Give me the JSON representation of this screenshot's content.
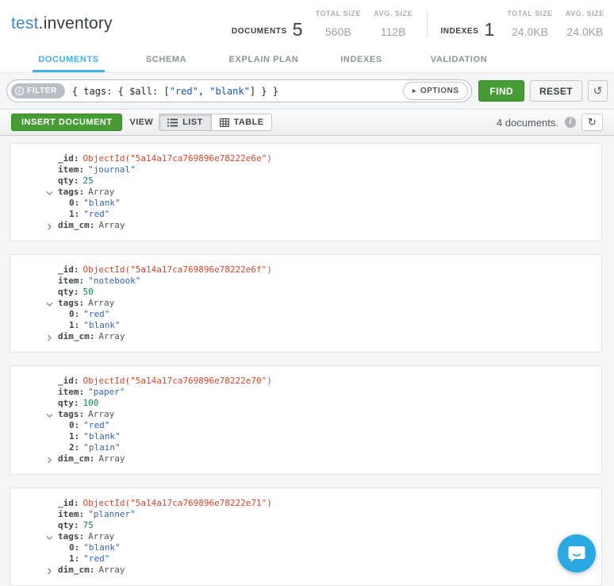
{
  "colors": {
    "accent_blue": "#43b1e4",
    "namespace_db_blue": "#4386c9",
    "button_green": "#469b35",
    "chat_blue": "#29a9e1",
    "objectid_red": "#d4472b",
    "string_blue": "#3265b4",
    "number_green": "#11824b"
  },
  "header": {
    "namespace": {
      "database": "test",
      "separator": ".",
      "collection": "inventory"
    },
    "stats": {
      "documents_label": "DOCUMENTS",
      "documents_count": "5",
      "documents_total_size_label": "TOTAL SIZE",
      "documents_total_size": "560B",
      "documents_avg_size_label": "AVG. SIZE",
      "documents_avg_size": "112B",
      "indexes_label": "INDEXES",
      "indexes_count": "1",
      "indexes_total_size_label": "TOTAL SIZE",
      "indexes_total_size": "24.0KB",
      "indexes_avg_size_label": "AVG. SIZE",
      "indexes_avg_size": "24.0KB"
    }
  },
  "tabs": [
    {
      "label": "DOCUMENTS",
      "active": true
    },
    {
      "label": "SCHEMA",
      "active": false
    },
    {
      "label": "EXPLAIN PLAN",
      "active": false
    },
    {
      "label": "INDEXES",
      "active": false
    },
    {
      "label": "VALIDATION",
      "active": false
    }
  ],
  "filter": {
    "badge_label": "FILTER",
    "badge_info_glyph": "i",
    "query_prefix": "{ tags: { $all: [",
    "query_string_1": "\"red\"",
    "query_separator": ", ",
    "query_string_2": "\"blank\"",
    "query_suffix": "] } }",
    "options_caret_glyph": "▸",
    "options_label": "OPTIONS",
    "find_label": "FIND",
    "reset_label": "RESET",
    "history_icon_glyph": "↺"
  },
  "toolbar": {
    "insert_label": "INSERT DOCUMENT",
    "view_label": "VIEW",
    "list_label": "LIST",
    "table_label": "TABLE",
    "count_text": "4 documents.",
    "info_icon_glyph": "i",
    "refresh_icon_glyph": "↻"
  },
  "documents": [
    {
      "fields": [
        {
          "key": "_id",
          "type": "objectid",
          "value": "ObjectId(\"5a14a17ca769896e78222e6e\")"
        },
        {
          "key": "item",
          "type": "string",
          "value": "\"journal\""
        },
        {
          "key": "qty",
          "type": "number",
          "value": "25"
        },
        {
          "key": "tags",
          "type": "array",
          "value": "Array",
          "expanded": true,
          "children": [
            {
              "key": "0",
              "type": "string",
              "value": "\"blank\""
            },
            {
              "key": "1",
              "type": "string",
              "value": "\"red\""
            }
          ]
        },
        {
          "key": "dim_cm",
          "type": "array",
          "value": "Array",
          "expanded": false
        }
      ]
    },
    {
      "fields": [
        {
          "key": "_id",
          "type": "objectid",
          "value": "ObjectId(\"5a14a17ca769896e78222e6f\")"
        },
        {
          "key": "item",
          "type": "string",
          "value": "\"notebook\""
        },
        {
          "key": "qty",
          "type": "number",
          "value": "50"
        },
        {
          "key": "tags",
          "type": "array",
          "value": "Array",
          "expanded": true,
          "children": [
            {
              "key": "0",
              "type": "string",
              "value": "\"red\""
            },
            {
              "key": "1",
              "type": "string",
              "value": "\"blank\""
            }
          ]
        },
        {
          "key": "dim_cm",
          "type": "array",
          "value": "Array",
          "expanded": false
        }
      ]
    },
    {
      "fields": [
        {
          "key": "_id",
          "type": "objectid",
          "value": "ObjectId(\"5a14a17ca769896e78222e70\")"
        },
        {
          "key": "item",
          "type": "string",
          "value": "\"paper\""
        },
        {
          "key": "qty",
          "type": "number",
          "value": "100"
        },
        {
          "key": "tags",
          "type": "array",
          "value": "Array",
          "expanded": true,
          "children": [
            {
              "key": "0",
              "type": "string",
              "value": "\"red\""
            },
            {
              "key": "1",
              "type": "string",
              "value": "\"blank\""
            },
            {
              "key": "2",
              "type": "string",
              "value": "\"plain\""
            }
          ]
        },
        {
          "key": "dim_cm",
          "type": "array",
          "value": "Array",
          "expanded": false
        }
      ]
    },
    {
      "fields": [
        {
          "key": "_id",
          "type": "objectid",
          "value": "ObjectId(\"5a14a17ca769896e78222e71\")"
        },
        {
          "key": "item",
          "type": "string",
          "value": "\"planner\""
        },
        {
          "key": "qty",
          "type": "number",
          "value": "75"
        },
        {
          "key": "tags",
          "type": "array",
          "value": "Array",
          "expanded": true,
          "children": [
            {
              "key": "0",
              "type": "string",
              "value": "\"blank\""
            },
            {
              "key": "1",
              "type": "string",
              "value": "\"red\""
            }
          ]
        },
        {
          "key": "dim_cm",
          "type": "array",
          "value": "Array",
          "expanded": false
        }
      ]
    }
  ]
}
